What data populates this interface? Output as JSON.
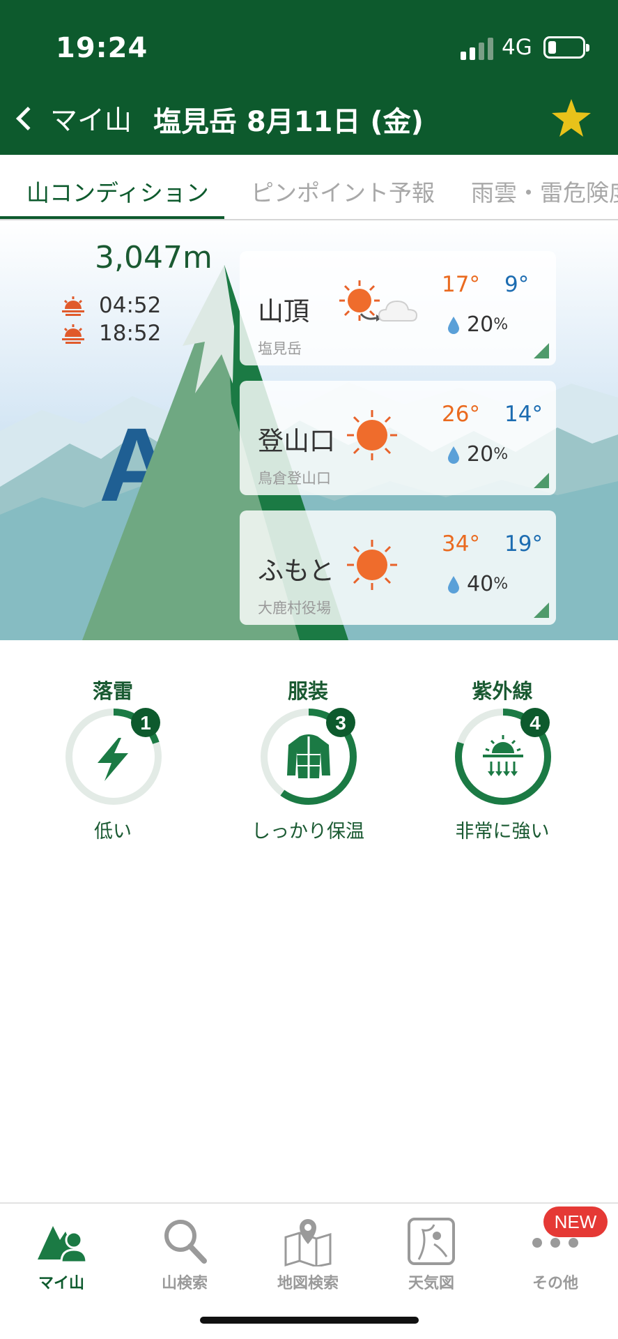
{
  "status_bar": {
    "time": "19:24",
    "network": "4G"
  },
  "nav_bar": {
    "back_label": "マイ山",
    "title": "塩見岳  8月11日 (金)"
  },
  "tabs": [
    {
      "label": "山コンディション",
      "active": true
    },
    {
      "label": "ピンポイント予報",
      "active": false
    },
    {
      "label": "雨雲・雷危険度",
      "active": false
    }
  ],
  "mountain": {
    "elevation": "3,047m",
    "sunrise": "04:52",
    "sunset": "18:52",
    "grade": "A"
  },
  "forecast": [
    {
      "name": "山頂",
      "sub": "塩見岳",
      "weather": "sunny-then-cloudy",
      "high": "17°",
      "low": "9°",
      "rain": "20",
      "rain_unit": "%"
    },
    {
      "name": "登山口",
      "sub": "鳥倉登山口",
      "weather": "sunny",
      "high": "26°",
      "low": "14°",
      "rain": "20",
      "rain_unit": "%"
    },
    {
      "name": "ふもと",
      "sub": "大鹿村役場",
      "weather": "sunny",
      "high": "34°",
      "low": "19°",
      "rain": "40",
      "rain_unit": "%"
    }
  ],
  "indicators": [
    {
      "title": "落雷",
      "level": "1",
      "level_fraction": 0.2,
      "value": "低い",
      "icon": "lightning-icon"
    },
    {
      "title": "服装",
      "level": "3",
      "level_fraction": 0.6,
      "value": "しっかり保温",
      "icon": "jacket-icon"
    },
    {
      "title": "紫外線",
      "level": "4",
      "level_fraction": 0.8,
      "value": "非常に強い",
      "icon": "uv-sun-icon"
    }
  ],
  "bottom_nav": [
    {
      "label": "マイ山",
      "icon": "my-mountain-icon",
      "active": true
    },
    {
      "label": "山検索",
      "icon": "search-icon",
      "active": false
    },
    {
      "label": "地図検索",
      "icon": "map-pin-icon",
      "active": false
    },
    {
      "label": "天気図",
      "icon": "weather-map-icon",
      "active": false
    },
    {
      "label": "その他",
      "icon": "more-icon",
      "active": false
    }
  ],
  "new_badge": "NEW",
  "colors": {
    "brand_green": "#0d5a2d",
    "temp_high": "#ea6a1f",
    "temp_low": "#1c6cb1",
    "badge_red": "#e53935"
  }
}
